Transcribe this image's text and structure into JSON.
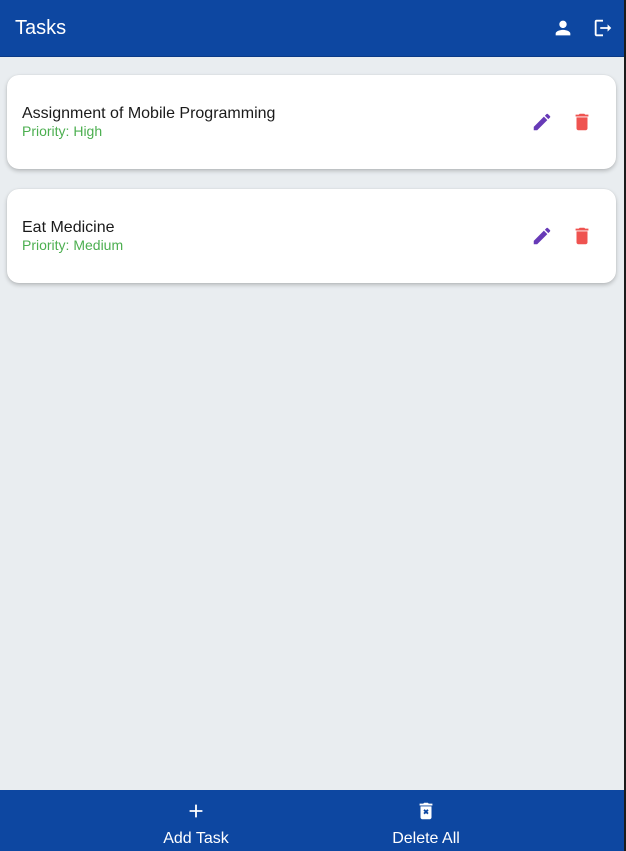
{
  "appbar": {
    "title": "Tasks",
    "actions": [
      {
        "icon": "person-icon"
      },
      {
        "icon": "logout-icon"
      }
    ],
    "background": "#0d47a1"
  },
  "tasks": [
    {
      "title": "Assignment of Mobile Programming",
      "priority": "Priority: High"
    },
    {
      "title": "Eat Medicine",
      "priority": "Priority: Medium"
    }
  ],
  "bottom_nav": {
    "add_label": "Add Task",
    "delete_all_label": "Delete All"
  },
  "colors": {
    "primary": "#0d47a1",
    "edit": "#673ab7",
    "delete": "#ef5350",
    "priority": "#4caf50",
    "background": "#e9edf0"
  }
}
